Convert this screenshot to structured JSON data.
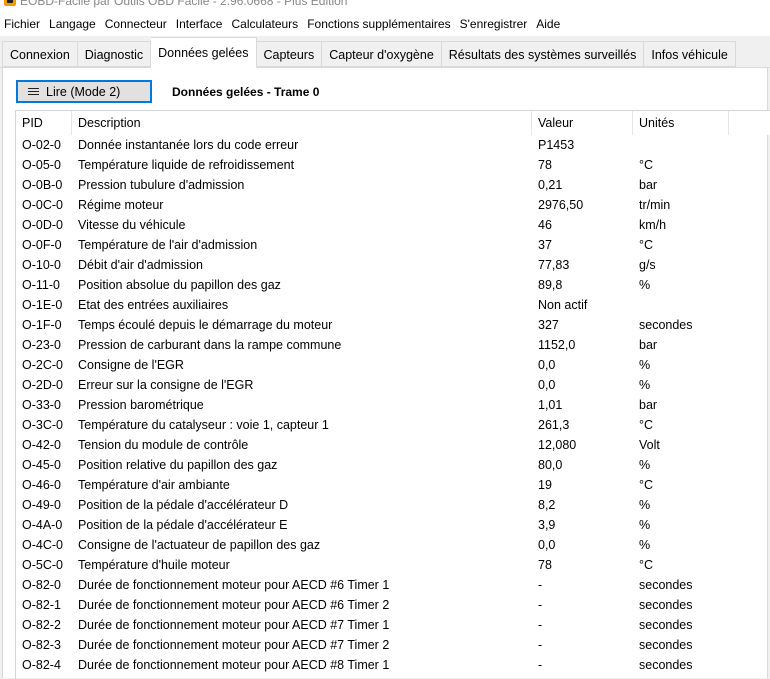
{
  "window": {
    "title": "EOBD-Facile par Outils OBD Facile - 2.96.0668 - Plus Edition"
  },
  "menu": [
    "Fichier",
    "Langage",
    "Connecteur",
    "Interface",
    "Calculateurs",
    "Fonctions supplémentaires",
    "S'enregistrer",
    "Aide"
  ],
  "tabs": [
    {
      "label": "Connexion",
      "active": false
    },
    {
      "label": "Diagnostic",
      "active": false
    },
    {
      "label": "Données gelées",
      "active": true
    },
    {
      "label": "Capteurs",
      "active": false
    },
    {
      "label": "Capteur d'oxygène",
      "active": false
    },
    {
      "label": "Résultats des systèmes surveillés",
      "active": false
    },
    {
      "label": "Infos véhicule",
      "active": false
    }
  ],
  "toolbar": {
    "read_button_label": "Lire (Mode 2)",
    "frame_label": "Données gelées - Trame 0"
  },
  "table": {
    "columns": {
      "pid": "PID",
      "description": "Description",
      "value": "Valeur",
      "units": "Unités"
    },
    "rows": [
      {
        "pid": "O-02-0",
        "description": "Donnée instantanée lors du code erreur",
        "value": "P1453",
        "units": ""
      },
      {
        "pid": "O-05-0",
        "description": "Température liquide de refroidissement",
        "value": "78",
        "units": "°C"
      },
      {
        "pid": "O-0B-0",
        "description": "Pression tubulure d'admission",
        "value": "0,21",
        "units": "bar"
      },
      {
        "pid": "O-0C-0",
        "description": "Régime moteur",
        "value": "2976,50",
        "units": "tr/min"
      },
      {
        "pid": "O-0D-0",
        "description": "Vitesse du véhicule",
        "value": "46",
        "units": "km/h"
      },
      {
        "pid": "O-0F-0",
        "description": "Température de l'air d'admission",
        "value": "37",
        "units": "°C"
      },
      {
        "pid": "O-10-0",
        "description": "Débit d'air d'admission",
        "value": "77,83",
        "units": "g/s"
      },
      {
        "pid": "O-11-0",
        "description": "Position absolue du papillon des gaz",
        "value": "89,8",
        "units": "%"
      },
      {
        "pid": "O-1E-0",
        "description": "Etat des entrées auxiliaires",
        "value": "Non actif",
        "units": ""
      },
      {
        "pid": "O-1F-0",
        "description": "Temps écoulé depuis le démarrage du moteur",
        "value": "327",
        "units": "secondes"
      },
      {
        "pid": "O-23-0",
        "description": "Pression de carburant dans la rampe commune",
        "value": "1152,0",
        "units": "bar"
      },
      {
        "pid": "O-2C-0",
        "description": "Consigne de l'EGR",
        "value": "0,0",
        "units": "%"
      },
      {
        "pid": "O-2D-0",
        "description": "Erreur sur la consigne de l'EGR",
        "value": "0,0",
        "units": "%"
      },
      {
        "pid": "O-33-0",
        "description": "Pression barométrique",
        "value": "1,01",
        "units": "bar"
      },
      {
        "pid": "O-3C-0",
        "description": "Température du catalyseur : voie 1, capteur 1",
        "value": "261,3",
        "units": "°C"
      },
      {
        "pid": "O-42-0",
        "description": "Tension du module de contrôle",
        "value": "12,080",
        "units": "Volt"
      },
      {
        "pid": "O-45-0",
        "description": "Position relative du papillon des gaz",
        "value": "80,0",
        "units": "%"
      },
      {
        "pid": "O-46-0",
        "description": "Température d'air ambiante",
        "value": "19",
        "units": "°C"
      },
      {
        "pid": "O-49-0",
        "description": "Position de la pédale d'accélérateur D",
        "value": "8,2",
        "units": "%"
      },
      {
        "pid": "O-4A-0",
        "description": "Position de la pédale d'accélérateur E",
        "value": "3,9",
        "units": "%"
      },
      {
        "pid": "O-4C-0",
        "description": "Consigne de l'actuateur de papillon des gaz",
        "value": "0,0",
        "units": "%"
      },
      {
        "pid": "O-5C-0",
        "description": "Température d'huile moteur",
        "value": "78",
        "units": "°C"
      },
      {
        "pid": "O-82-0",
        "description": "Durée de fonctionnement moteur pour AECD #6 Timer 1",
        "value": "-",
        "units": "secondes"
      },
      {
        "pid": "O-82-1",
        "description": "Durée de fonctionnement moteur pour AECD #6 Timer 2",
        "value": "-",
        "units": "secondes"
      },
      {
        "pid": "O-82-2",
        "description": "Durée de fonctionnement moteur pour AECD #7 Timer 1",
        "value": "-",
        "units": "secondes"
      },
      {
        "pid": "O-82-3",
        "description": "Durée de fonctionnement moteur pour AECD #7 Timer 2",
        "value": "-",
        "units": "secondes"
      },
      {
        "pid": "O-82-4",
        "description": "Durée de fonctionnement moteur pour AECD #8 Timer 1",
        "value": "-",
        "units": "secondes"
      }
    ]
  }
}
